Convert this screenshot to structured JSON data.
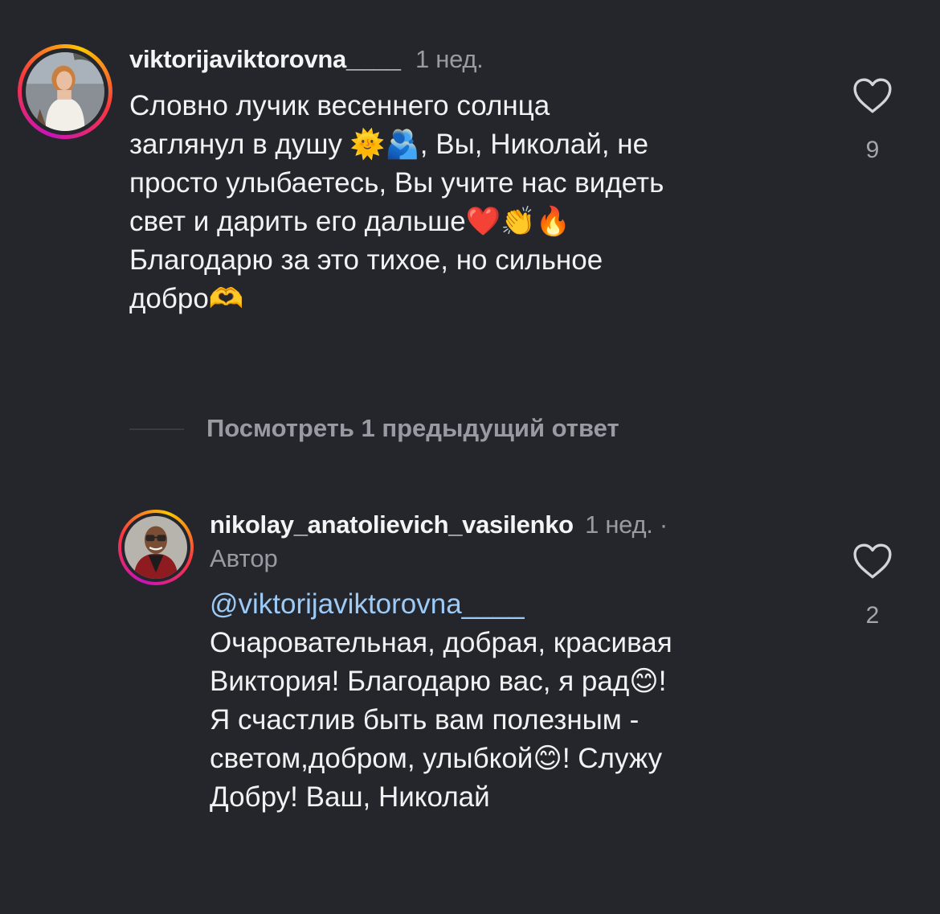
{
  "comment": {
    "username": "viktorijaviktorovna____",
    "time": "1 нед.",
    "lines": [
      "Словно лучик весеннего солнца",
      "заглянул в душу 🌞🫂, Вы, Николай, не",
      "просто улыбаетесь, Вы учите нас видеть",
      "свет и дарить его дальше❤️👏🔥",
      "Благодарю за это тихое, но сильное",
      "добро🫶"
    ],
    "like_count": "9",
    "like_icon": "heart-outline-icon"
  },
  "replies_toggle": {
    "label": "Посмотреть 1 предыдущий ответ"
  },
  "reply": {
    "username": "nikolay_anatolievich_vasilenko",
    "time": "1 нед. ·",
    "author_label": "Автор",
    "mention": "@viktorijaviktorovna____",
    "lines": [
      "Очаровательная, добрая, красивая",
      "Виктория! Благодарю вас, я рад😊!",
      "Я счастлив быть вам полезным -",
      "светом,добром, улыбкой😊! Служу",
      "Добру! Ваш, Николай"
    ],
    "like_count": "2",
    "like_icon": "heart-outline-icon"
  },
  "colors": {
    "background": "#25262c",
    "text": "#f2f2f4",
    "secondary": "#9a9ba2",
    "mention": "#9ccbf7",
    "ring_gradient": [
      "#c913b9",
      "#f9373f",
      "#fec700"
    ]
  }
}
